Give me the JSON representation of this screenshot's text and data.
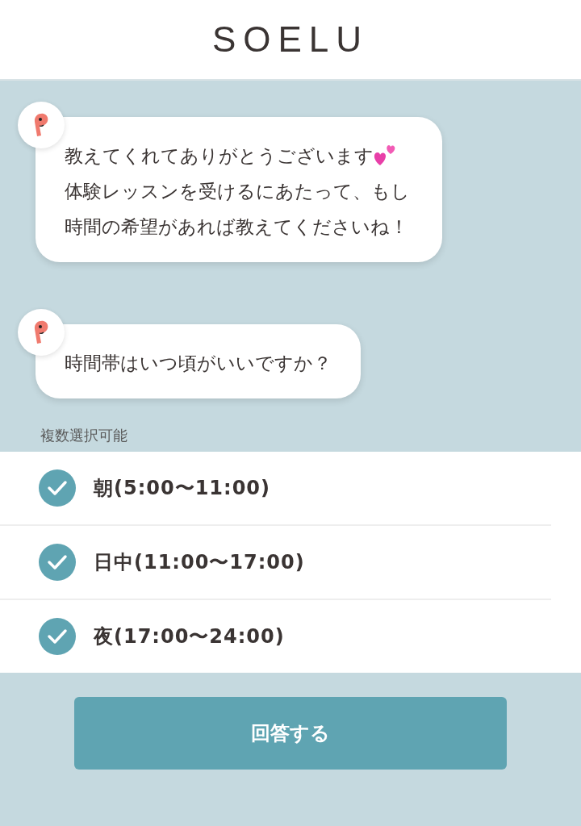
{
  "header": {
    "logo": "SOELU"
  },
  "messages": [
    {
      "parts": [
        "教えてくれてありがとうございます",
        "体験レッスンを受けるにあたって、もし時間の希望があれば教えてくださいね！"
      ]
    },
    {
      "parts": [
        "時間帯はいつ頃がいいですか？"
      ]
    }
  ],
  "hint": "複数選択可能",
  "options": [
    {
      "label": "朝",
      "time": "(5:00〜11:00)",
      "checked": true
    },
    {
      "label": "日中",
      "time": "(11:00〜17:00)",
      "checked": true
    },
    {
      "label": "夜",
      "time": "(17:00〜24:00)",
      "checked": true
    }
  ],
  "submit": "回答する"
}
